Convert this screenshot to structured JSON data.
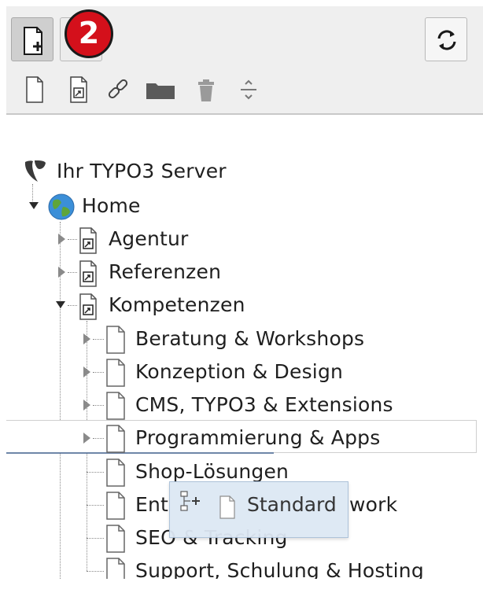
{
  "badge": {
    "number": "2"
  },
  "tree": {
    "root_label": "Ihr TYPO3 Server",
    "home_label": "Home",
    "items": [
      {
        "label": "Agentur"
      },
      {
        "label": "Referenzen"
      },
      {
        "label": "Kompetenzen"
      },
      {
        "label": "Beratung & Workshops"
      },
      {
        "label": "Konzeption & Design"
      },
      {
        "label": "CMS, TYPO3 & Extensions"
      },
      {
        "label": "Programmierung & Apps"
      },
      {
        "label": "Shop-Lösungen"
      },
      {
        "label": "Ent"
      },
      {
        "label": "work"
      },
      {
        "label": "SEO & Tracking"
      },
      {
        "label": "Support, Schulung & Hosting"
      }
    ]
  },
  "drag": {
    "label": "Standard"
  },
  "colors": {
    "badge": "#d4101b",
    "drop_line": "#6f86a8",
    "drag_bg": "#dde8f4",
    "globe": "#3b8fd8"
  }
}
